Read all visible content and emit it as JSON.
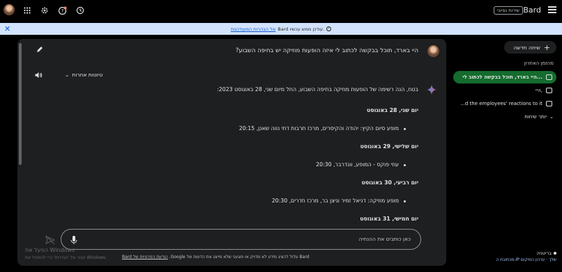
{
  "header": {
    "logo": "Bard",
    "badge": "שירות נסיוני",
    "icons": [
      "apps-grid-icon",
      "settings-gear-icon",
      "help-icon",
      "history-icon",
      "hamburger-menu-icon"
    ]
  },
  "banner": {
    "text": "Bard עודכן ממש עכשיו.",
    "link": "אל הבהרות המעודכנות"
  },
  "conversation": {
    "user_prompt": "היי בארד, תוכל בבקשה לכתוב לי איזה הופעות מוזיקה יש בחיפה השבוע?",
    "drafts_label": "טיוטות אחרות",
    "intro": "בטח, הנה רשימה של הופעות מוזיקה בחיפה השבוע, החל מיום שני, 28 באוגוסט 2023:",
    "schedule": [
      {
        "day": "יום שני, 28 באוגוסט",
        "event": "מופע סיום הקיץ: יהודה והקיסרים, מרכז תרבות דתי נווה שאנן, 20:15"
      },
      {
        "day": "יום שלישי, 29 באוגוסט",
        "event": "עוזי פוקס - המופע, וונדרבר, 20:30"
      },
      {
        "day": "יום רביעי, 30 באוגוסט",
        "event": "מופע מוזיקה: דניאל זמיר וניצן בר, מרכז חדרים, 20:30"
      },
      {
        "day": "יום חמישי, 31 באוגוסט",
        "event": ""
      }
    ]
  },
  "composer": {
    "placeholder": "כאן כותבים את ההנחיה",
    "disclaimer": "Bard עלול להציג מידע לא מדויק או פוגעני שלא מייצג את הדעות של Google.",
    "disclaimer_link": "הודעת הפרטיות של Bard"
  },
  "watermark": {
    "line1": "הפעל את Windows",
    "line2": "עבור אל 'הגדרות' כדי להפעיל את Windows."
  },
  "sidebar": {
    "new_chat": "שיחה חדשה",
    "recent_title": "מהזמן האחרון",
    "items": [
      {
        "label": "היי בארד, תוכל בבקשה לכתוב לי...",
        "active": true
      },
      {
        "label": "היי,",
        "active": false
      },
      {
        "label": "...d the employees' reactions to it",
        "active": false
      }
    ],
    "more": "יותר שיחות",
    "location_name": "בריטניה",
    "location_link": "מכתובת ה-IP שלך · עדכון המיקום"
  },
  "colors": {
    "background": "#000000",
    "panel": "#1e1f20",
    "banner": "#d3e3fd",
    "active_item": "#146c2e",
    "accent": "#0b57d0"
  }
}
